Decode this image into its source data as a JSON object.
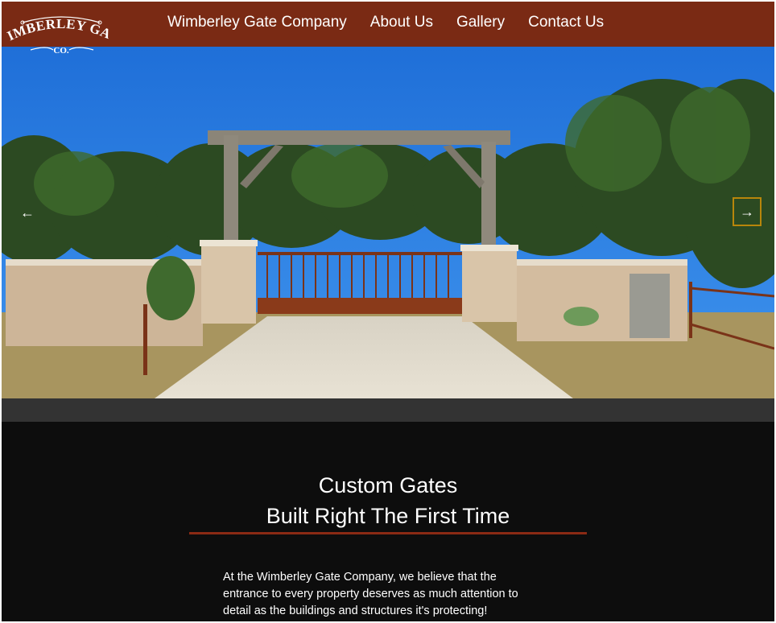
{
  "brand": {
    "logo_text_top": "WIMBERLEY GATE",
    "logo_text_bottom": "CO.",
    "header_color": "#7a2a14"
  },
  "nav": {
    "items": [
      {
        "label": "Wimberley Gate Company"
      },
      {
        "label": "About Us"
      },
      {
        "label": "Gallery"
      },
      {
        "label": "Contact Us"
      }
    ]
  },
  "carousel": {
    "prev_icon": "arrow-left-icon",
    "next_icon": "arrow-right-icon",
    "prev_glyph": "←",
    "next_glyph": "→",
    "active_border_color": "#b8860b"
  },
  "main": {
    "heading_line1": "Custom Gates",
    "heading_line2": "Built Right The First Time",
    "accent_color": "#8b2a14",
    "intro": "At the Wimberley Gate Company, we believe that the entrance to every property deserves as much attention to detail as the buildings and structures it's protecting!"
  }
}
